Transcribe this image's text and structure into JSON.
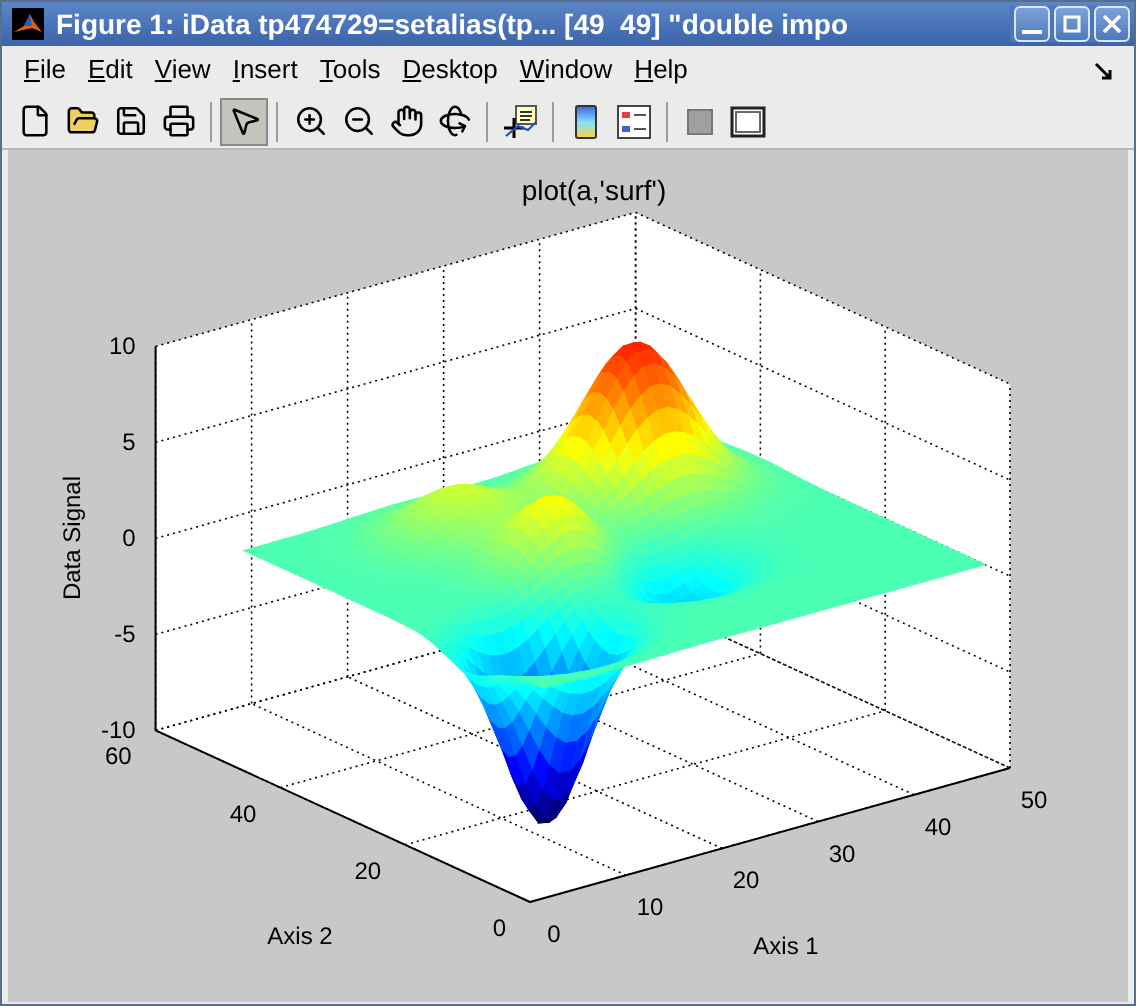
{
  "window": {
    "title": "Figure 1: iData tp474729=setalias(tp... [49  49] \"double impo"
  },
  "menu": [
    {
      "label": "File"
    },
    {
      "label": "Edit"
    },
    {
      "label": "View"
    },
    {
      "label": "Insert"
    },
    {
      "label": "Tools"
    },
    {
      "label": "Desktop"
    },
    {
      "label": "Window"
    },
    {
      "label": "Help"
    }
  ],
  "toolbar": [
    [
      {
        "kind": "new",
        "selected": false
      },
      {
        "kind": "open",
        "selected": false
      },
      {
        "kind": "save",
        "selected": false
      },
      {
        "kind": "print",
        "selected": false
      }
    ],
    [
      {
        "kind": "pointer",
        "selected": true
      }
    ],
    [
      {
        "kind": "zoom-in",
        "selected": false
      },
      {
        "kind": "zoom-out",
        "selected": false
      },
      {
        "kind": "pan",
        "selected": false
      },
      {
        "kind": "rotate",
        "selected": false
      }
    ],
    [
      {
        "kind": "data-cursor",
        "selected": false
      }
    ],
    [
      {
        "kind": "colorbar",
        "selected": false
      },
      {
        "kind": "legend",
        "selected": false
      }
    ],
    [
      {
        "kind": "hide-tools",
        "selected": false
      },
      {
        "kind": "show-tools",
        "selected": false
      }
    ]
  ],
  "plot": {
    "title": "plot(a,'surf')",
    "zlabel": "Data Signal",
    "xlabel": "Axis 1",
    "ylabel": "Axis 2",
    "zticks": [
      "10",
      "5",
      "0",
      "-5",
      "-10"
    ],
    "xticks": [
      "0",
      "10",
      "20",
      "30",
      "40",
      "50"
    ],
    "yticks": [
      "0",
      "20",
      "40",
      "60"
    ]
  }
}
